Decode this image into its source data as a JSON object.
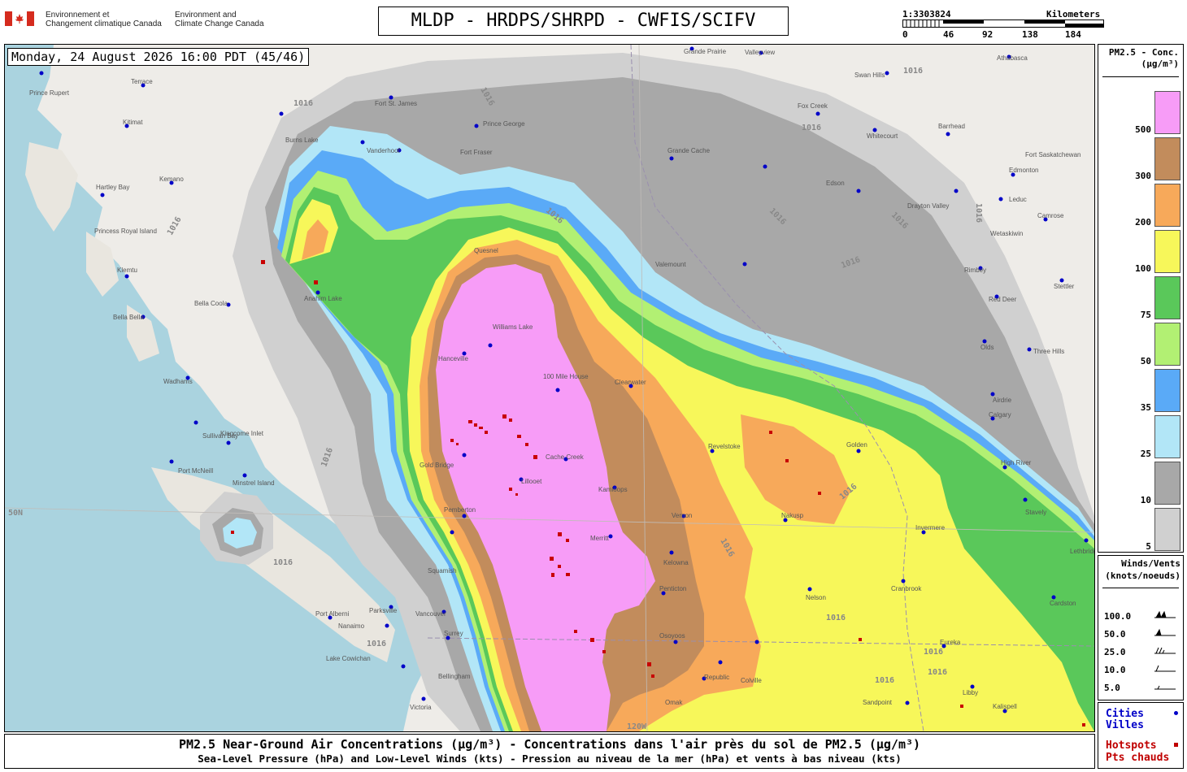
{
  "header": {
    "gov_fr_line1": "Environnement et",
    "gov_fr_line2": "Changement climatique Canada",
    "gov_en_line1": "Environment and",
    "gov_en_line2": "Climate Change Canada",
    "title": "MLDP - HRDPS/SHRPD - CWFIS/SCIFV"
  },
  "scale": {
    "ratio": "1:3303824",
    "unit": "Kilometers",
    "ticks": [
      "0",
      "46",
      "92",
      "138",
      "184"
    ]
  },
  "timestamp": "Monday, 24 August 2026 16:00 PDT (45/46)",
  "caption": {
    "line1": "PM2.5 Near-Ground Air Concentrations (µg/m³) - Concentrations dans l'air près du sol de PM2.5 (µg/m³)",
    "line2": "Sea-Level Pressure (hPa) and Low-Level Winds (kts) - Pression au niveau de la mer (hPa) et vents à bas niveau (kts)"
  },
  "legend": {
    "title_line1": "PM2.5 - Conc.",
    "title_line2": "(µg/m³)",
    "levels": [
      {
        "label": "500",
        "color": "#f79cf7"
      },
      {
        "label": "300",
        "color": "#c28c5c"
      },
      {
        "label": "200",
        "color": "#f7a95a"
      },
      {
        "label": "100",
        "color": "#f7f75a"
      },
      {
        "label": "75",
        "color": "#5ac85a"
      },
      {
        "label": "50",
        "color": "#b2f073"
      },
      {
        "label": "35",
        "color": "#5aaaf7"
      },
      {
        "label": "25",
        "color": "#b2e6f7"
      },
      {
        "label": "10",
        "color": "#a8a8a8"
      },
      {
        "label": "5",
        "color": "#d0d0d0"
      }
    ]
  },
  "wind_legend": {
    "title_line1": "Winds/Vents",
    "title_line2": "(knots/noeuds)",
    "speeds": [
      "100.0",
      "50.0",
      "25.0",
      "10.0",
      "5.0"
    ]
  },
  "map_key": {
    "cities_en": "Cities",
    "cities_fr": "Villes",
    "hotspots_en": "Hotspots",
    "hotspots_fr": "Pts chauds"
  },
  "map": {
    "isobar_label": "1016",
    "lat_label": "50N",
    "lon_label": "120W",
    "places": [
      {
        "name": "Prince Rupert"
      },
      {
        "name": "Terrace"
      },
      {
        "name": "Kitimat"
      },
      {
        "name": "Kemano"
      },
      {
        "name": "Hartley Bay"
      },
      {
        "name": "Princess Royal Island"
      },
      {
        "name": "Klemtu"
      },
      {
        "name": "Bella Bella"
      },
      {
        "name": "Bella Coola"
      },
      {
        "name": "Wadhams"
      },
      {
        "name": "Sullivan Bay"
      },
      {
        "name": "Kingcome Inlet"
      },
      {
        "name": "Port McNeill"
      },
      {
        "name": "Minstrel Island"
      },
      {
        "name": "Port Alberni"
      },
      {
        "name": "Parksville"
      },
      {
        "name": "Nanaimo"
      },
      {
        "name": "Lake Cowichan"
      },
      {
        "name": "Victoria"
      },
      {
        "name": "Vancouver"
      },
      {
        "name": "Surrey"
      },
      {
        "name": "Bellingham"
      },
      {
        "name": "Squamish"
      },
      {
        "name": "Pemberton"
      },
      {
        "name": "Gold Bridge"
      },
      {
        "name": "Hanceville"
      },
      {
        "name": "Williams Lake"
      },
      {
        "name": "100 Mile House"
      },
      {
        "name": "Clearwater"
      },
      {
        "name": "Kamloops"
      },
      {
        "name": "Cache Creek"
      },
      {
        "name": "Lillooet"
      },
      {
        "name": "Merritt"
      },
      {
        "name": "Vernon"
      },
      {
        "name": "Kelowna"
      },
      {
        "name": "Penticton"
      },
      {
        "name": "Osoyoos"
      },
      {
        "name": "Omak"
      },
      {
        "name": "Republic"
      },
      {
        "name": "Colville"
      },
      {
        "name": "Revelstoke"
      },
      {
        "name": "Nakusp"
      },
      {
        "name": "Nelson"
      },
      {
        "name": "Cranbrook"
      },
      {
        "name": "Eureka"
      },
      {
        "name": "Libby"
      },
      {
        "name": "Sandpoint"
      },
      {
        "name": "Kalispell"
      },
      {
        "name": "Golden"
      },
      {
        "name": "Invermere"
      },
      {
        "name": "Calgary"
      },
      {
        "name": "High River"
      },
      {
        "name": "Stavely"
      },
      {
        "name": "Lethbridge"
      },
      {
        "name": "Cardston"
      },
      {
        "name": "Airdrie"
      },
      {
        "name": "Olds"
      },
      {
        "name": "Three Hills"
      },
      {
        "name": "Red Deer"
      },
      {
        "name": "Stettler"
      },
      {
        "name": "Rimbey"
      },
      {
        "name": "Wetaskiwin"
      },
      {
        "name": "Camrose"
      },
      {
        "name": "Leduc"
      },
      {
        "name": "Edmonton"
      },
      {
        "name": "Fort Saskatchewan"
      },
      {
        "name": "Drayton Valley"
      },
      {
        "name": "Edson"
      },
      {
        "name": "Whitecourt"
      },
      {
        "name": "Barrhead"
      },
      {
        "name": "Fox Creek"
      },
      {
        "name": "Swan Hills"
      },
      {
        "name": "Athabasca"
      },
      {
        "name": "Valleyview"
      },
      {
        "name": "Grande Prairie"
      },
      {
        "name": "Grande Cache"
      },
      {
        "name": "Valemount"
      },
      {
        "name": "Prince George"
      },
      {
        "name": "Vanderhoof"
      },
      {
        "name": "Fort St. James"
      },
      {
        "name": "Quesnel"
      },
      {
        "name": "Burns Lake"
      },
      {
        "name": "Fort Fraser"
      },
      {
        "name": "Anahim Lake"
      }
    ]
  }
}
